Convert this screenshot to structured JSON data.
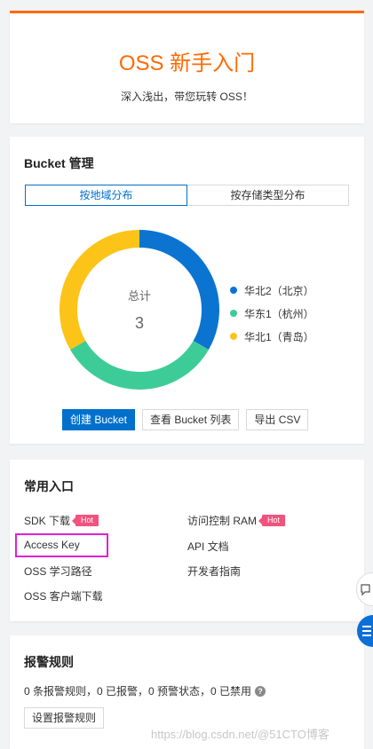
{
  "intro": {
    "title": "OSS 新手入门",
    "subtitle": "深入浅出，带您玩转 OSS！"
  },
  "bucket": {
    "title": "Bucket 管理",
    "tabs": [
      "按地域分布",
      "按存储类型分布"
    ],
    "active_tab": 0,
    "total_label": "总计",
    "total_value": "3",
    "buttons": {
      "create": "创建 Bucket",
      "view_list": "查看 Bucket 列表",
      "export": "导出 CSV"
    }
  },
  "chart_data": {
    "type": "pie",
    "style": "donut",
    "categories": [
      "华北2（北京）",
      "华东1（杭州）",
      "华北1（青岛）"
    ],
    "values": [
      1,
      1,
      1
    ],
    "colors": [
      "#0b74d1",
      "#3dcc98",
      "#fcc419"
    ],
    "legend_position": "right"
  },
  "entry": {
    "title": "常用入口",
    "links": [
      {
        "label": "SDK 下载",
        "hot": true
      },
      {
        "label": "访问控制 RAM",
        "hot": true
      },
      {
        "label": "Access Key",
        "hot": false
      },
      {
        "label": "API 文档",
        "hot": false
      },
      {
        "label": "OSS 学习路径",
        "hot": false
      },
      {
        "label": "开发者指南",
        "hot": false
      },
      {
        "label": "OSS 客户端下载",
        "hot": false
      }
    ],
    "hot_label": "Hot"
  },
  "alarm": {
    "title": "报警规则",
    "summary": "0 条报警规则，0 已报警，0 预警状态，0 已禁用",
    "help_glyph": "?",
    "setup_button": "设置报警规则"
  },
  "watermark": "https://blog.csdn.net/@51CTO博客"
}
